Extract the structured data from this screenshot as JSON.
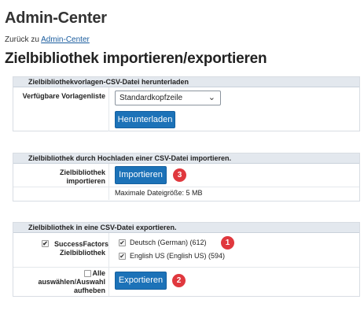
{
  "page": {
    "title": "Admin-Center",
    "back_prefix": "Zurück zu ",
    "back_link": "Admin-Center",
    "heading": "Zielbibliothek importieren/exportieren"
  },
  "download": {
    "header": "Zielbibliothekvorlagen-CSV-Datei herunterladen",
    "label": "Verfügbare Vorlagenliste",
    "select_value": "Standardkopfzeile",
    "button": "Herunterladen"
  },
  "import": {
    "header": "Zielbibliothek durch Hochladen einer CSV-Datei importieren.",
    "label": "Zielbibliothek importieren",
    "button": "Importieren",
    "max_size": "Maximale Dateigröße: 5 MB",
    "badge": "3"
  },
  "export": {
    "header": "Zielbibliothek in eine CSV-Datei exportieren.",
    "label": "SuccessFactors Zielbibliothek",
    "options": [
      {
        "label": "Deutsch (German) (612)",
        "checked": true
      },
      {
        "label": "English US (English US) (594)",
        "checked": true
      }
    ],
    "select_all_label": "Alle auswählen/Auswahl aufheben",
    "button": "Exportieren",
    "badge_options": "1",
    "badge_button": "2"
  },
  "colors": {
    "button": "#1c72b8",
    "badge": "#e0383e",
    "section_header": "#e3e8ee"
  }
}
